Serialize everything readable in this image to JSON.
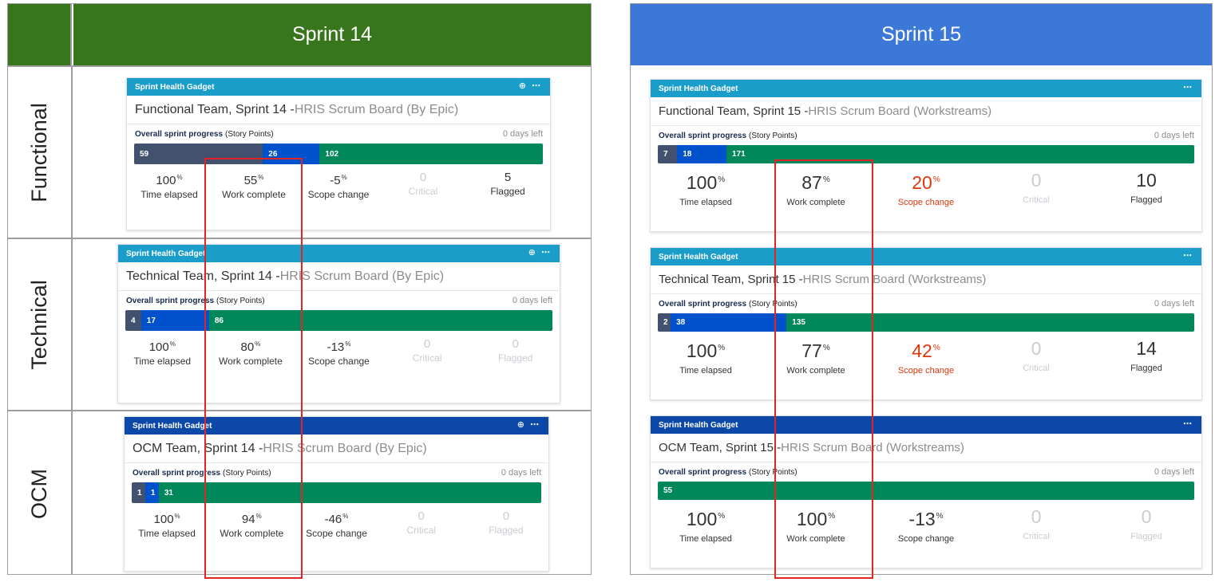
{
  "columns": {
    "sprint14": "Sprint 14",
    "sprint15": "Sprint 15"
  },
  "row_labels": [
    "Functional",
    "Technical",
    "OCM"
  ],
  "gadget_header": "Sprint Health Gadget",
  "header_tools_glyph": "⊕ ⋯",
  "header_tools_glyph_compact": "⋯",
  "colors": {
    "sprint14_header": "#38761d",
    "sprint15_header": "#3c78d8",
    "gadget_teal": "#1b9dc9",
    "gadget_navy": "#0b48a8",
    "todo": "#42526e",
    "in_progress": "#0052cc",
    "done": "#00875a",
    "highlight": "#e32424",
    "warning": "#de350b"
  },
  "sprint14": [
    {
      "team": "Functional Team, Sprint 14 - ",
      "board": "HRIS Scrum Board (By Epic)",
      "progress_label": "Overall sprint progress",
      "progress_unit": "(Story Points)",
      "days_left": "0 days left",
      "bar": [
        "59",
        "26",
        "102"
      ],
      "stats": [
        {
          "value": "100",
          "unit": "%",
          "label": "Time elapsed"
        },
        {
          "value": "55",
          "unit": "%",
          "label": "Work complete"
        },
        {
          "value": "-5",
          "unit": "%",
          "label": "Scope change"
        },
        {
          "value": "0",
          "unit": "",
          "label": "Critical"
        },
        {
          "value": "5",
          "unit": "",
          "label": "Flagged"
        }
      ]
    },
    {
      "team": "Technical Team, Sprint 14 - ",
      "board": "HRIS Scrum Board (By Epic)",
      "progress_label": "Overall sprint progress",
      "progress_unit": "(Story Points)",
      "days_left": "0 days left",
      "bar": [
        "4",
        "17",
        "86"
      ],
      "stats": [
        {
          "value": "100",
          "unit": "%",
          "label": "Time elapsed"
        },
        {
          "value": "80",
          "unit": "%",
          "label": "Work complete"
        },
        {
          "value": "-13",
          "unit": "%",
          "label": "Scope change"
        },
        {
          "value": "0",
          "unit": "",
          "label": "Critical"
        },
        {
          "value": "0",
          "unit": "",
          "label": "Flagged"
        }
      ]
    },
    {
      "team": "OCM Team, Sprint 14 - ",
      "board": "HRIS Scrum Board (By Epic)",
      "progress_label": "Overall sprint progress",
      "progress_unit": "(Story Points)",
      "days_left": "0 days left",
      "bar": [
        "1",
        "1",
        "31"
      ],
      "stats": [
        {
          "value": "100",
          "unit": "%",
          "label": "Time elapsed"
        },
        {
          "value": "94",
          "unit": "%",
          "label": "Work complete"
        },
        {
          "value": "-46",
          "unit": "%",
          "label": "Scope change"
        },
        {
          "value": "0",
          "unit": "",
          "label": "Critical"
        },
        {
          "value": "0",
          "unit": "",
          "label": "Flagged"
        }
      ]
    }
  ],
  "sprint15": [
    {
      "team": "Functional Team, Sprint 15 - ",
      "board": "HRIS Scrum Board (Workstreams)",
      "progress_label": "Overall sprint progress",
      "progress_unit": "(Story Points)",
      "days_left": "0 days left",
      "bar": [
        "7",
        "18",
        "171"
      ],
      "stats": [
        {
          "value": "100",
          "unit": "%",
          "label": "Time elapsed"
        },
        {
          "value": "87",
          "unit": "%",
          "label": "Work complete"
        },
        {
          "value": "20",
          "unit": "%",
          "label": "Scope change"
        },
        {
          "value": "0",
          "unit": "",
          "label": "Critical"
        },
        {
          "value": "10",
          "unit": "",
          "label": "Flagged"
        }
      ]
    },
    {
      "team": "Technical Team, Sprint 15 - ",
      "board": "HRIS Scrum Board (Workstreams)",
      "progress_label": "Overall sprint progress",
      "progress_unit": "(Story Points)",
      "days_left": "0 days left",
      "bar": [
        "2",
        "38",
        "135"
      ],
      "stats": [
        {
          "value": "100",
          "unit": "%",
          "label": "Time elapsed"
        },
        {
          "value": "77",
          "unit": "%",
          "label": "Work complete"
        },
        {
          "value": "42",
          "unit": "%",
          "label": "Scope change"
        },
        {
          "value": "0",
          "unit": "",
          "label": "Critical"
        },
        {
          "value": "14",
          "unit": "",
          "label": "Flagged"
        }
      ]
    },
    {
      "team": "OCM Team, Sprint 15 - ",
      "board": "HRIS Scrum Board (Workstreams)",
      "progress_label": "Overall sprint progress",
      "progress_unit": "(Story Points)",
      "days_left": "0 days left",
      "bar": [
        "55"
      ],
      "stats": [
        {
          "value": "100",
          "unit": "%",
          "label": "Time elapsed"
        },
        {
          "value": "100",
          "unit": "%",
          "label": "Work complete"
        },
        {
          "value": "-13",
          "unit": "%",
          "label": "Scope change"
        },
        {
          "value": "0",
          "unit": "",
          "label": "Critical"
        },
        {
          "value": "0",
          "unit": "",
          "label": "Flagged"
        }
      ]
    }
  ]
}
